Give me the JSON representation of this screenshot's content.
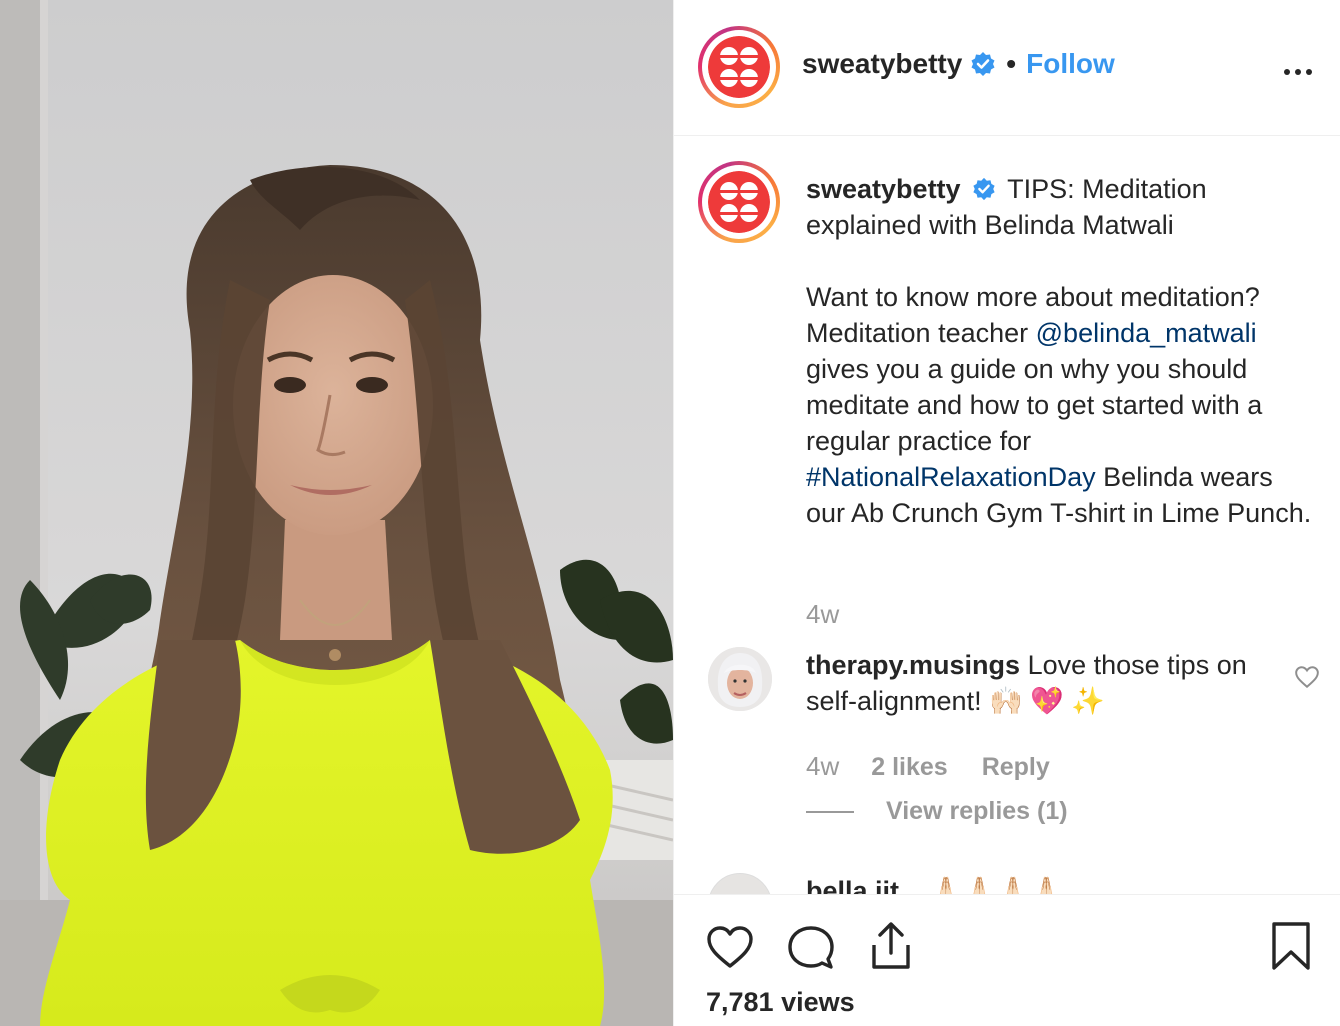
{
  "post": {
    "username": "sweatybetty",
    "follow_label": "Follow",
    "separator": "•",
    "more_label": "•••"
  },
  "caption": {
    "username": "sweatybetty",
    "line1_text": "TIPS: Meditation explained with Belinda Matwali",
    "para2_a": "Want to know more about meditation? Meditation teacher ",
    "mention": "@belinda_matwali",
    "para2_b": " gives you a guide on why you should meditate and how to get started with a regular practice for ",
    "hashtag": "#NationalRelaxationDay",
    "para2_c": " Belinda wears our Ab Crunch Gym T-shirt in Lime Punch.",
    "time": "4w"
  },
  "comment": {
    "username": "therapy.musings",
    "text": "Love those tips on self-alignment! 🙌🏻 💖 ✨",
    "time": "4w",
    "likes": "2 likes",
    "reply": "Reply",
    "view_replies": "View replies (1)"
  },
  "next_comment": {
    "text": "bella.ijt... 🙏🏻🙏🏻🙏🏻🙏🏻"
  },
  "footer": {
    "views": "7,781 views"
  },
  "colors": {
    "brand_red": "#ee3a3a",
    "link_blue": "#3897f0",
    "mention_blue": "#003569",
    "muted": "#999999",
    "verified_blue": "#3897f0"
  },
  "icons": [
    "verified-icon",
    "more-icon",
    "heart-icon",
    "comment-icon",
    "share-icon",
    "bookmark-icon"
  ]
}
